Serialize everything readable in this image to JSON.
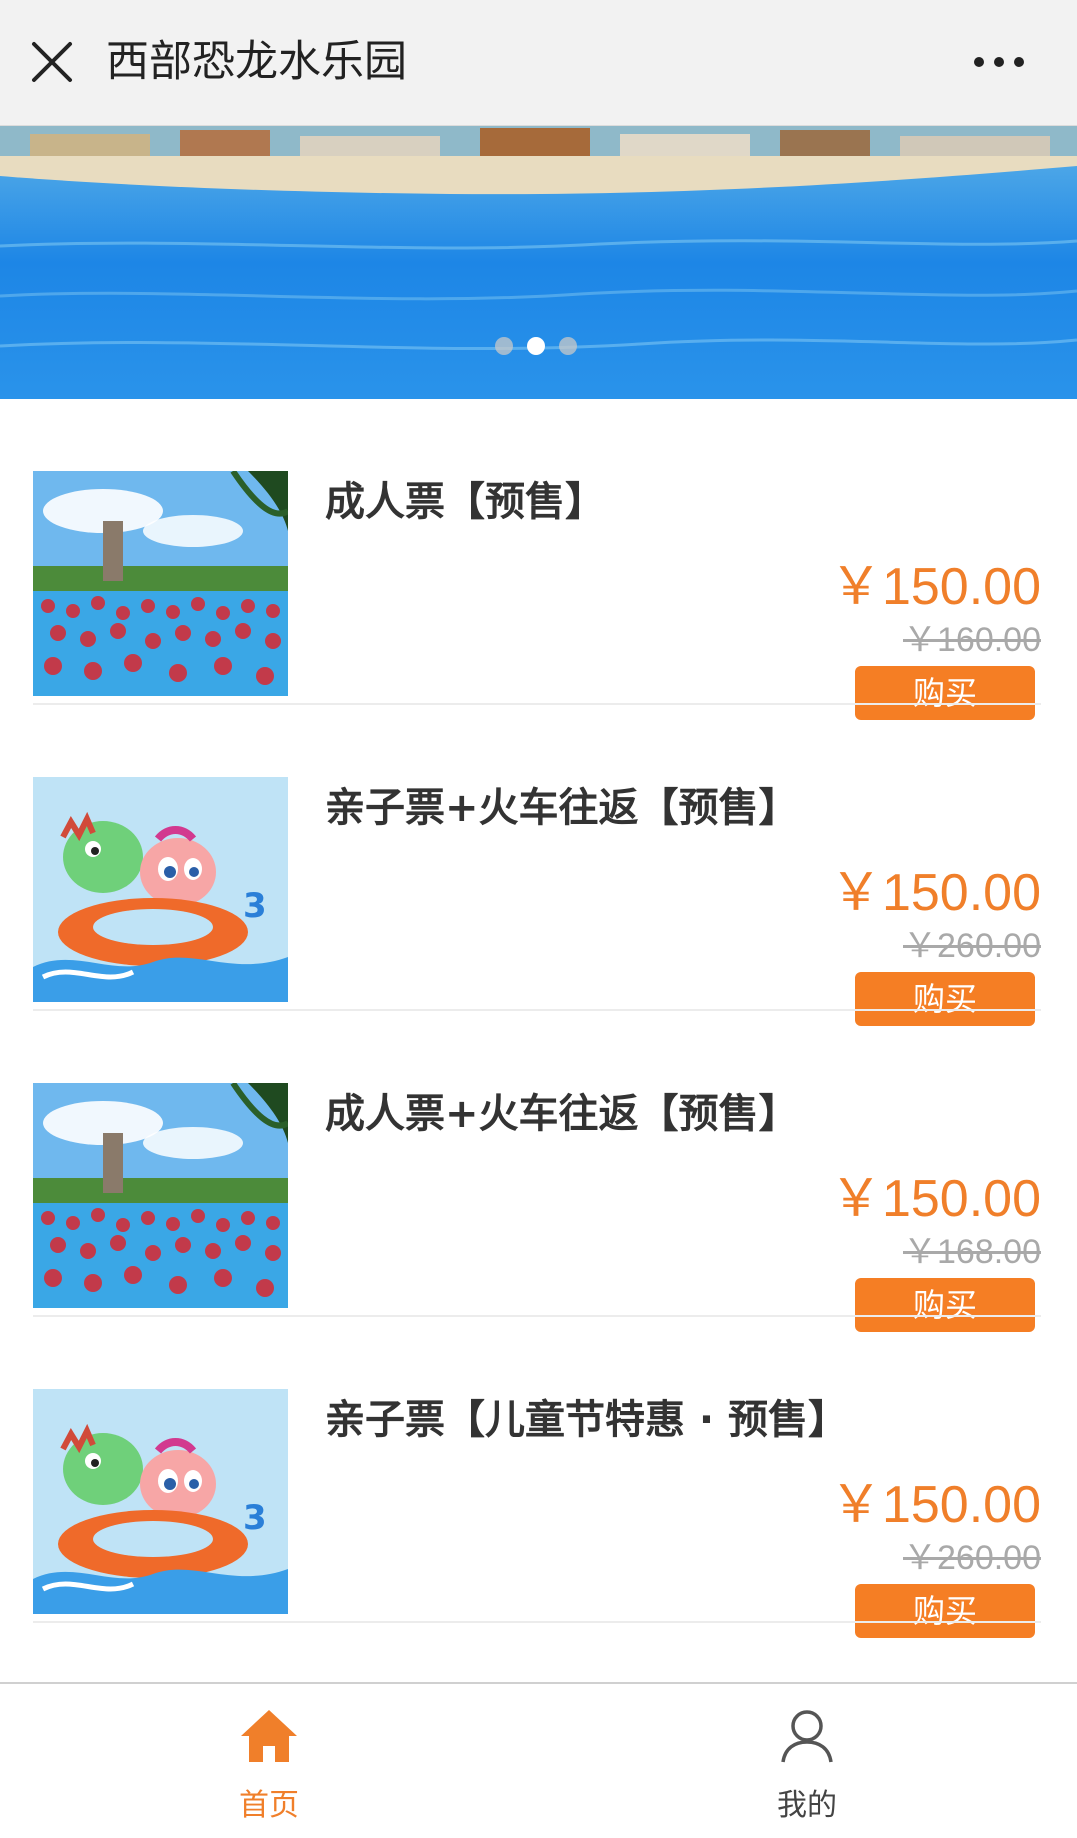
{
  "header": {
    "title": "西部恐龙水乐园",
    "close_icon": "close-icon",
    "more_icon": "more-dots-icon"
  },
  "banner": {
    "slide_count": 3,
    "active_slide": 2
  },
  "products": [
    {
      "name": "成人票【预售】",
      "price": "￥150.00",
      "original_price": "￥160.00",
      "buy_label": "购买",
      "thumbnail": "crowded-pool-photo"
    },
    {
      "name": "亲子票+火车往返【预售】",
      "price": "￥150.00",
      "original_price": "￥260.00",
      "buy_label": "购买",
      "thumbnail": "cartoon-dinosaurs-pool-float"
    },
    {
      "name": "成人票+火车往返【预售】",
      "price": "￥150.00",
      "original_price": "￥168.00",
      "buy_label": "购买",
      "thumbnail": "crowded-pool-photo"
    },
    {
      "name": "亲子票【儿童节特惠 · 预售】",
      "price": "￥150.00",
      "original_price": "￥260.00",
      "buy_label": "购买",
      "thumbnail": "cartoon-dinosaurs-pool-float"
    }
  ],
  "tabbar": {
    "home_label": "首页",
    "mine_label": "我的",
    "active": "home"
  },
  "colors": {
    "accent": "#f07f2a",
    "button": "#f57e24",
    "strike": "#a9a9a9",
    "header_bg": "#f2f2f2"
  }
}
